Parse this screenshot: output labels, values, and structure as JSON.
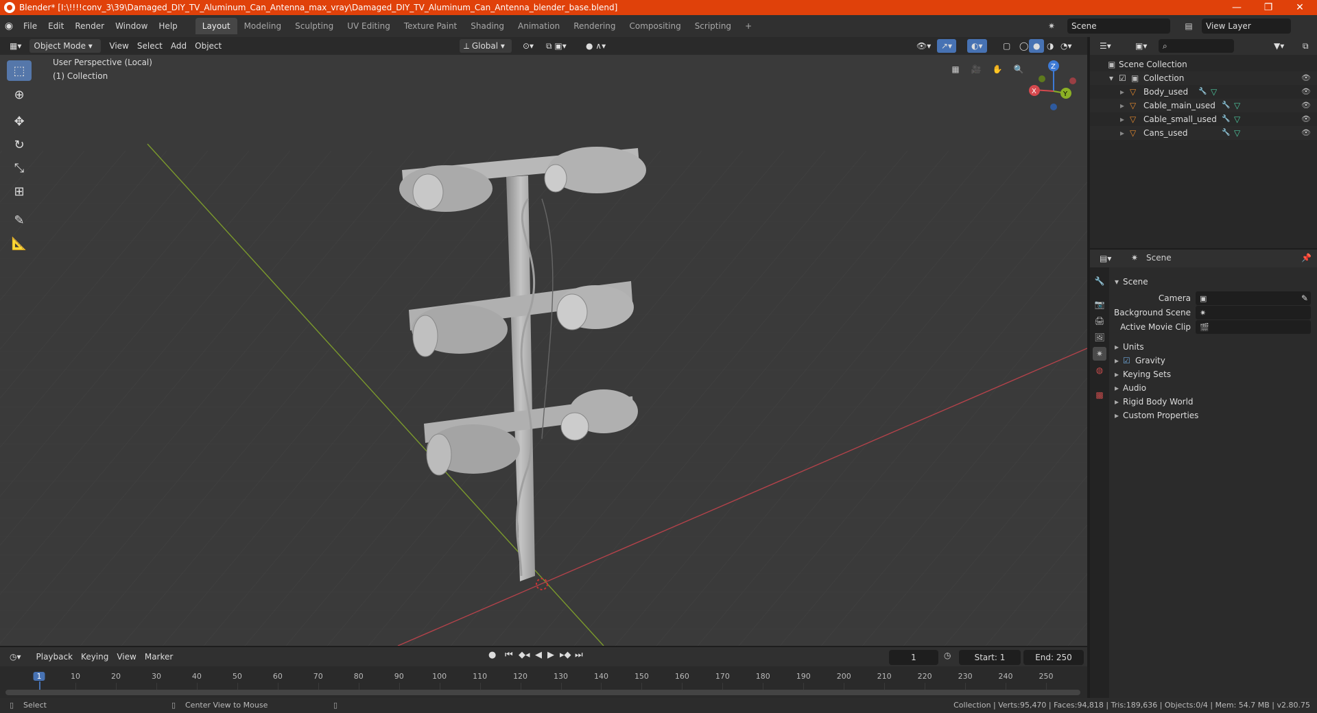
{
  "window": {
    "title": "Blender* [I:\\!!!!conv_3\\39\\Damaged_DIY_TV_Aluminum_Can_Antenna_max_vray\\Damaged_DIY_TV_Aluminum_Can_Antenna_blender_base.blend]",
    "minimize": "—",
    "maximize": "❐",
    "close": "✕"
  },
  "menu": [
    "File",
    "Edit",
    "Render",
    "Window",
    "Help"
  ],
  "workspaces": [
    "Layout",
    "Modeling",
    "Sculpting",
    "UV Editing",
    "Texture Paint",
    "Shading",
    "Animation",
    "Rendering",
    "Compositing",
    "Scripting"
  ],
  "active_workspace": "Layout",
  "add_workspace": "+",
  "scene_selector": "Scene",
  "view_layer_selector": "View Layer",
  "viewport": {
    "mode": "Object Mode",
    "menus": [
      "View",
      "Select",
      "Add",
      "Object"
    ],
    "transform_orientation": "Global",
    "overlay_text_line1": "User Perspective (Local)",
    "overlay_text_line2": "(1) Collection",
    "gizmo_axes": {
      "x": "X",
      "y": "Y",
      "z": "Z"
    }
  },
  "outliner": {
    "root": "Scene Collection",
    "collection": "Collection",
    "items": [
      "Body_used",
      "Cable_main_used",
      "Cable_small_used",
      "Cans_used"
    ]
  },
  "properties": {
    "header": "Scene",
    "panel_title": "Scene",
    "fields": [
      {
        "label": "Camera",
        "value": ""
      },
      {
        "label": "Background Scene",
        "value": ""
      },
      {
        "label": "Active Movie Clip",
        "value": ""
      }
    ],
    "sections": [
      "Units",
      "Gravity",
      "Keying Sets",
      "Audio",
      "Rigid Body World",
      "Custom Properties"
    ]
  },
  "timeline": {
    "menus": [
      "Playback",
      "Keying",
      "View",
      "Marker"
    ],
    "current_frame": "1",
    "start_label": "Start:",
    "start": "1",
    "end_label": "End:",
    "end": "250",
    "ticks": [
      "1",
      "10",
      "20",
      "30",
      "40",
      "50",
      "60",
      "70",
      "80",
      "90",
      "100",
      "110",
      "120",
      "130",
      "140",
      "150",
      "160",
      "170",
      "180",
      "190",
      "200",
      "210",
      "220",
      "230",
      "240",
      "250"
    ]
  },
  "statusbar": {
    "left1": "Select",
    "left2": "Center View to Mouse",
    "stats": "Collection | Verts:95,470 | Faces:94,818 | Tris:189,636 | Objects:0/4 | Mem: 54.7 MB | v2.80.75"
  },
  "colors": {
    "title_bar": "#e0410a",
    "accent": "#4772b3",
    "x_axis": "#d6494e",
    "y_axis": "#8bb025",
    "z_axis": "#3d7ad6",
    "object_orange": "#e68a2e"
  }
}
